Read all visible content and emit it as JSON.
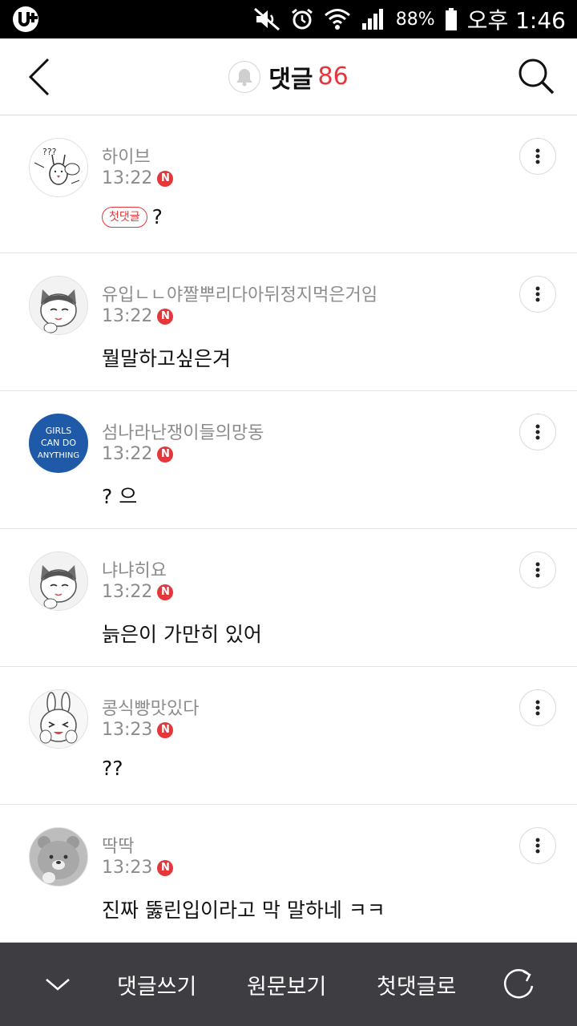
{
  "status_bar": {
    "battery_percent": "88%",
    "time": "오후 1:46"
  },
  "header": {
    "title": "댓글",
    "count": "86"
  },
  "comments": [
    {
      "author": "하이브",
      "time": "13:22",
      "new_badge": "N",
      "first_badge": "첫댓글",
      "text": "?",
      "avatar_icon": "rabbit-sticker-avatar"
    },
    {
      "author": "유입ㄴㄴ야짤뿌리다아뒤정지먹은거임",
      "time": "13:22",
      "new_badge": "N",
      "text": "뭘말하고싶은겨",
      "avatar_icon": "cat-character-avatar"
    },
    {
      "author": "섬나라난쟁이들의망동",
      "time": "13:22",
      "new_badge": "N",
      "text": "? 으",
      "avatar_icon": "girls-can-do-anything-avatar",
      "avatar_text": [
        "GIRLS",
        "CAN DO",
        "ANYTHING"
      ]
    },
    {
      "author": "냐냐히요",
      "time": "13:22",
      "new_badge": "N",
      "text": "늙은이 가만히 있어",
      "avatar_icon": "cat-character-avatar"
    },
    {
      "author": "콩식빵맛있다",
      "time": "13:23",
      "new_badge": "N",
      "text": "??",
      "avatar_icon": "rabbit-character-avatar"
    },
    {
      "author": "딱딱",
      "time": "13:23",
      "new_badge": "N",
      "text": "진짜 뚫린입이라고 막 말하네 ㅋㅋ",
      "avatar_icon": "bear-character-avatar"
    }
  ],
  "bottom_bar": {
    "write_label": "댓글쓰기",
    "original_label": "원문보기",
    "first_comment_label": "첫댓글로"
  },
  "colors": {
    "accent_red": "#e5373b",
    "bottom_bar_bg": "#3d3d42",
    "meta_gray": "#8c8c8c"
  }
}
